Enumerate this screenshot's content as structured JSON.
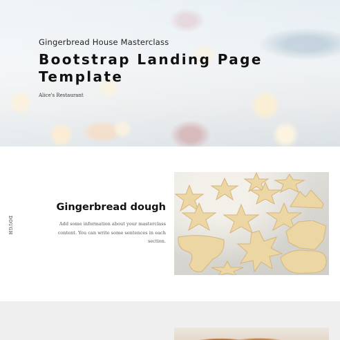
{
  "hero": {
    "eyebrow": "Gingerbread House Masterclass",
    "title": "Bootstrap Landing Page Template",
    "subtitle": "Alice's Restaurant"
  },
  "section1": {
    "side_label": "DOUGH",
    "title": "Gingerbread dough",
    "description": "Add some information about your masterclass content. You can write some sentences in each section."
  },
  "colors": {
    "hero_bg": "#e6eef3",
    "section2_bg": "#efefef",
    "cookie_dough": "#ecd6a4"
  }
}
